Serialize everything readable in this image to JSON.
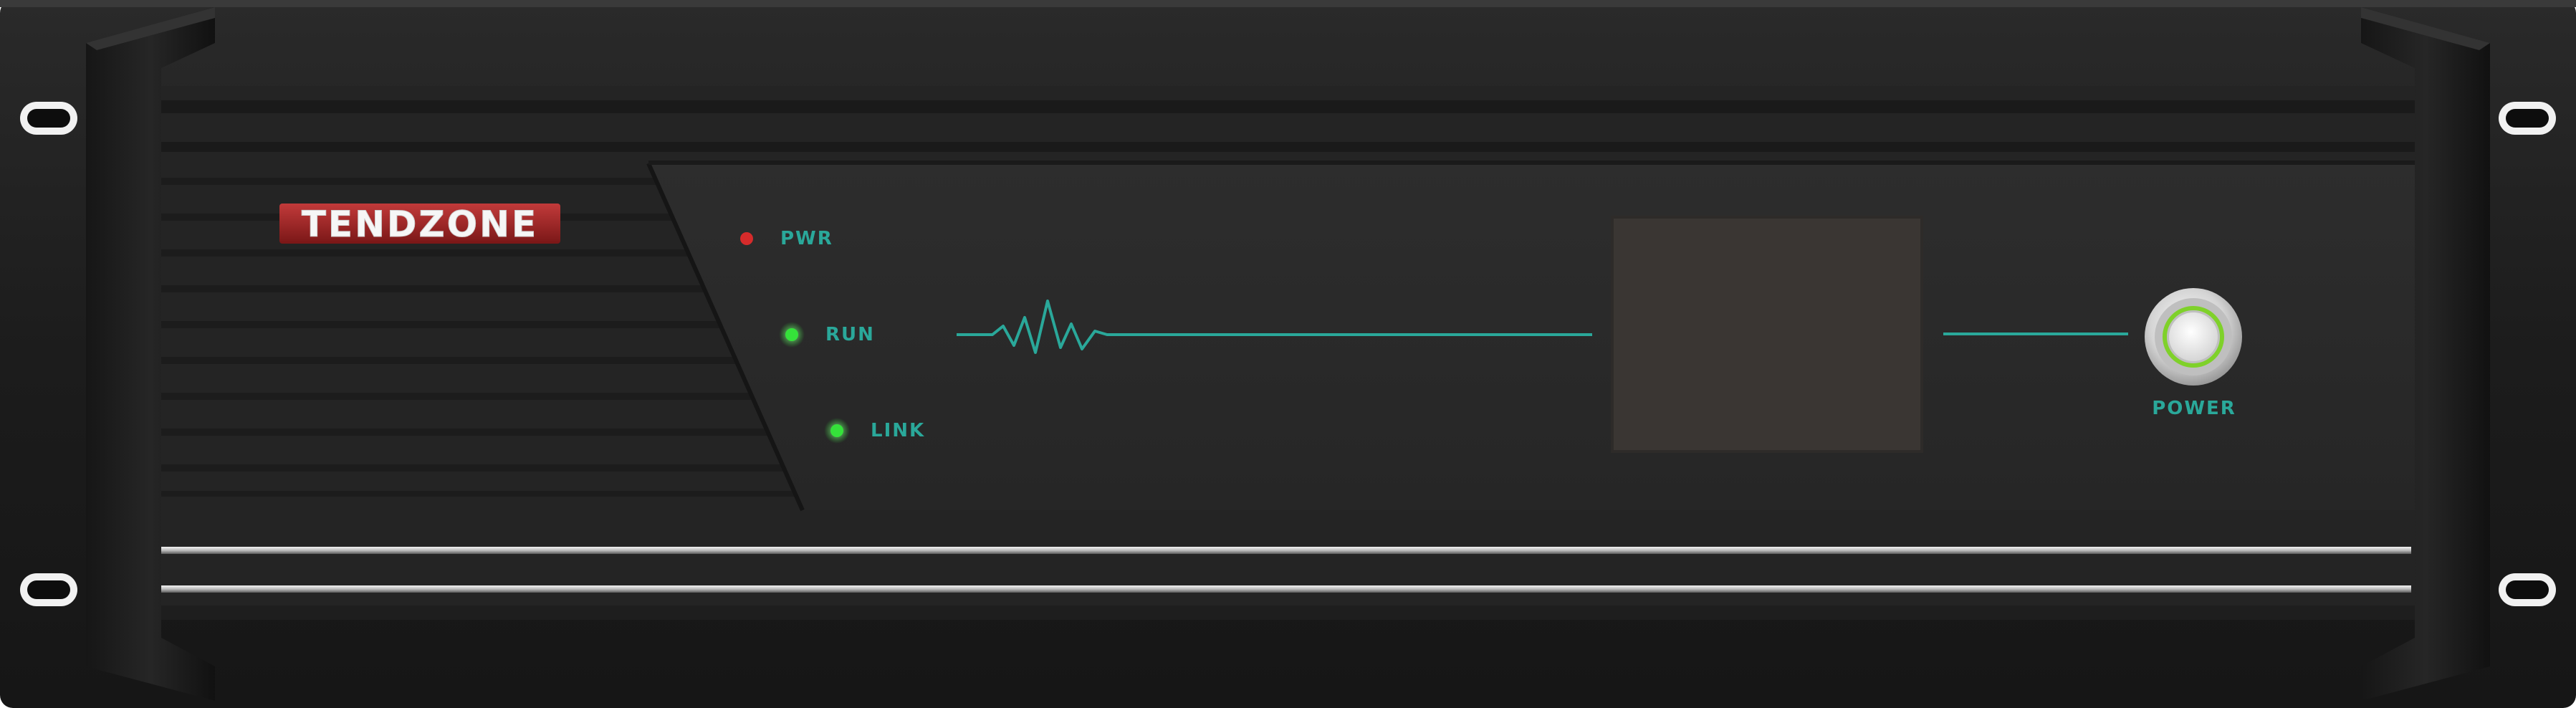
{
  "brand": {
    "logo_text": "TENDZONE"
  },
  "indicators": [
    {
      "label": "PWR",
      "led_color": "#d62b2b"
    },
    {
      "label": "RUN",
      "led_color": "#35e23a"
    },
    {
      "label": "LINK",
      "led_color": "#35e23a"
    }
  ],
  "power_button": {
    "label": "POWER",
    "ring_color": "#7fd12a"
  },
  "colors": {
    "accent": "#2aa89a",
    "panel": "#2a2a2a",
    "chassis": "#1b1b1b",
    "display": "#3a3633"
  }
}
